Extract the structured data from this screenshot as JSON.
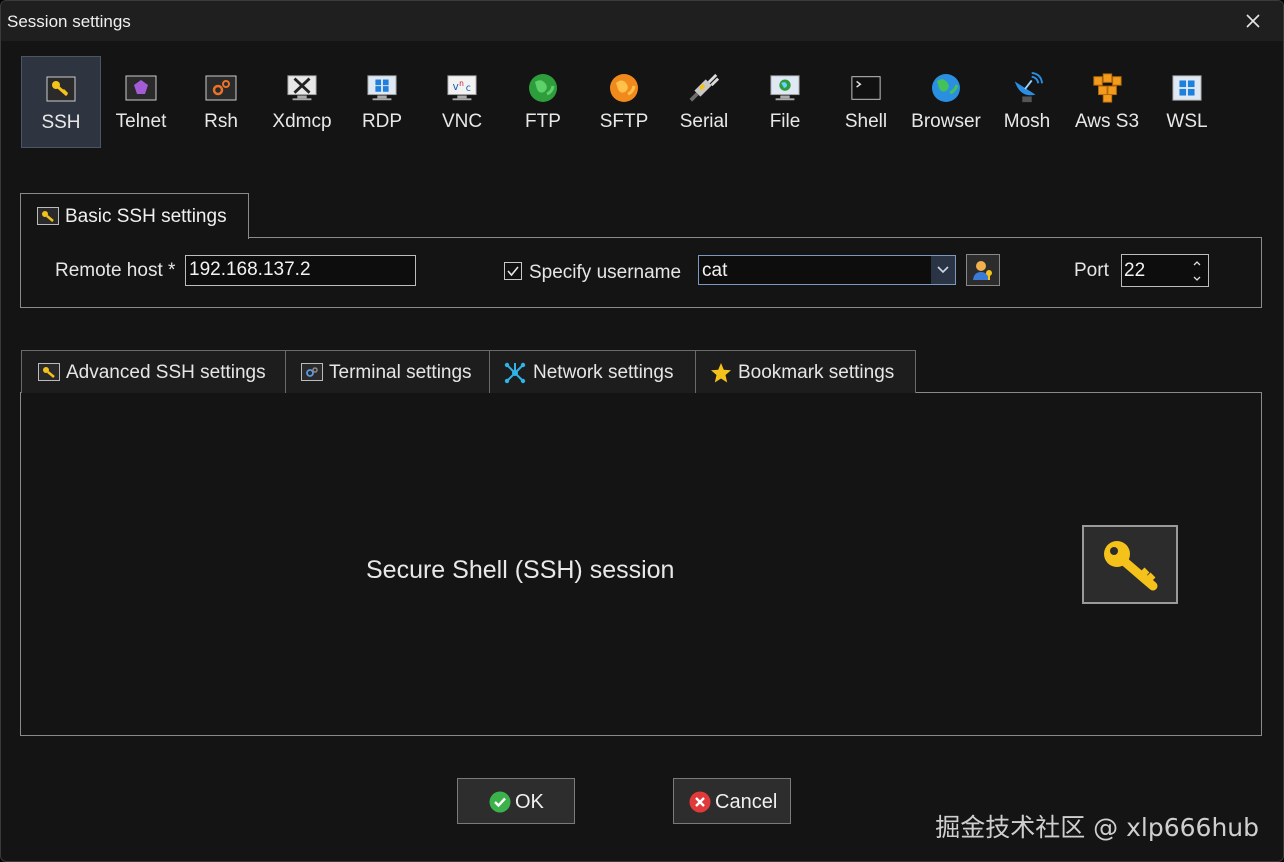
{
  "window": {
    "title": "Session settings"
  },
  "session_types": [
    {
      "label": "SSH",
      "icon": "key-icon",
      "selected": true
    },
    {
      "label": "Telnet",
      "icon": "telnet-icon",
      "selected": false
    },
    {
      "label": "Rsh",
      "icon": "rsh-icon",
      "selected": false
    },
    {
      "label": "Xdmcp",
      "icon": "xdmcp-icon",
      "selected": false
    },
    {
      "label": "RDP",
      "icon": "rdp-icon",
      "selected": false
    },
    {
      "label": "VNC",
      "icon": "vnc-icon",
      "selected": false
    },
    {
      "label": "FTP",
      "icon": "ftp-globe-icon",
      "selected": false
    },
    {
      "label": "SFTP",
      "icon": "sftp-icon",
      "selected": false
    },
    {
      "label": "Serial",
      "icon": "serial-plug-icon",
      "selected": false
    },
    {
      "label": "File",
      "icon": "file-monitor-icon",
      "selected": false
    },
    {
      "label": "Shell",
      "icon": "shell-terminal-icon",
      "selected": false
    },
    {
      "label": "Browser",
      "icon": "browser-globe-icon",
      "selected": false
    },
    {
      "label": "Mosh",
      "icon": "mosh-dish-icon",
      "selected": false
    },
    {
      "label": "Aws S3",
      "icon": "aws-s3-icon",
      "selected": false
    },
    {
      "label": "WSL",
      "icon": "wsl-windows-icon",
      "selected": false
    }
  ],
  "basic": {
    "tab_label": "Basic SSH settings",
    "remote_host_label": "Remote host *",
    "remote_host_value": "192.168.137.2",
    "specify_username_label": "Specify username",
    "specify_username_checked": true,
    "username_value": "cat",
    "port_label": "Port",
    "port_value": "22"
  },
  "tabs": [
    {
      "label": "Advanced SSH settings",
      "icon": "key-icon"
    },
    {
      "label": "Terminal settings",
      "icon": "terminal-settings-icon"
    },
    {
      "label": "Network settings",
      "icon": "network-icon"
    },
    {
      "label": "Bookmark settings",
      "icon": "star-icon"
    }
  ],
  "panel": {
    "description": "Secure Shell (SSH) session"
  },
  "buttons": {
    "ok": "OK",
    "cancel": "Cancel"
  },
  "watermark": "掘金技术社区 @ xlp666hub",
  "colors": {
    "ok_green": "#3bb34a",
    "cancel_red": "#e03a3a",
    "key_gold": "#f4c21b"
  }
}
